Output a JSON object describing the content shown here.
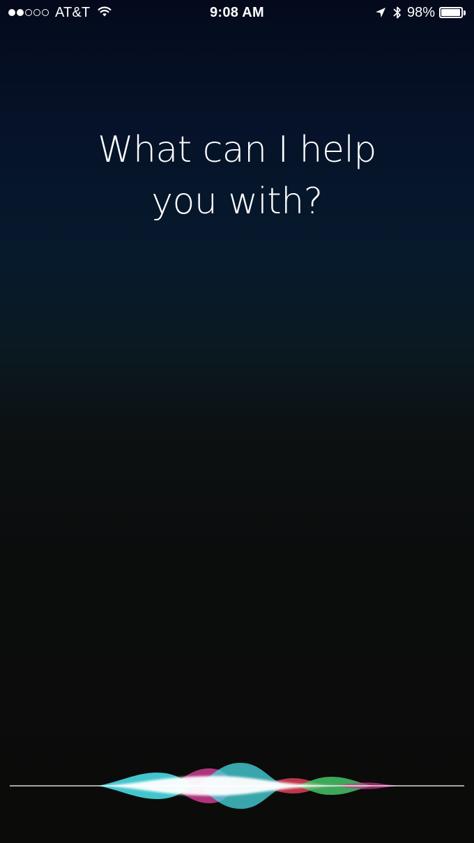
{
  "status_bar": {
    "signal": {
      "filled_dots": 2,
      "total_dots": 5
    },
    "carrier": "AT&T",
    "wifi_icon": "wifi-icon",
    "time": "9:08 AM",
    "location_icon": "location-arrow-icon",
    "bluetooth_icon": "bluetooth-icon",
    "battery_percent": "98%",
    "battery_level": 0.98
  },
  "siri": {
    "prompt_line1": "What can I help",
    "prompt_line2": "you with?",
    "waveform_icon": "siri-waveform-icon",
    "waveform_colors": {
      "cyan": "#3fd8e0",
      "magenta": "#c8328c",
      "red": "#d8364e",
      "green": "#3ec060",
      "white": "#ffffff"
    }
  },
  "colors": {
    "background_top": "#040a1c",
    "background_bottom": "#0b0c0c",
    "text": "#ffffff"
  }
}
